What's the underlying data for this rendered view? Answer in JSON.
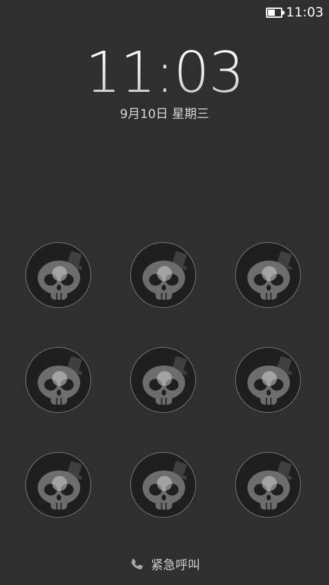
{
  "status_bar": {
    "time": "11:03",
    "battery_icon": "battery-icon",
    "battery_level": 0.55
  },
  "lockscreen": {
    "clock": "11:03",
    "date": "9月10日 星期三"
  },
  "pattern": {
    "dot_icon": "skull-with-top-hat-icon",
    "dots": [
      1,
      2,
      3,
      4,
      5,
      6,
      7,
      8,
      9
    ]
  },
  "emergency": {
    "icon": "phone-icon",
    "label": "紧急呼叫"
  }
}
